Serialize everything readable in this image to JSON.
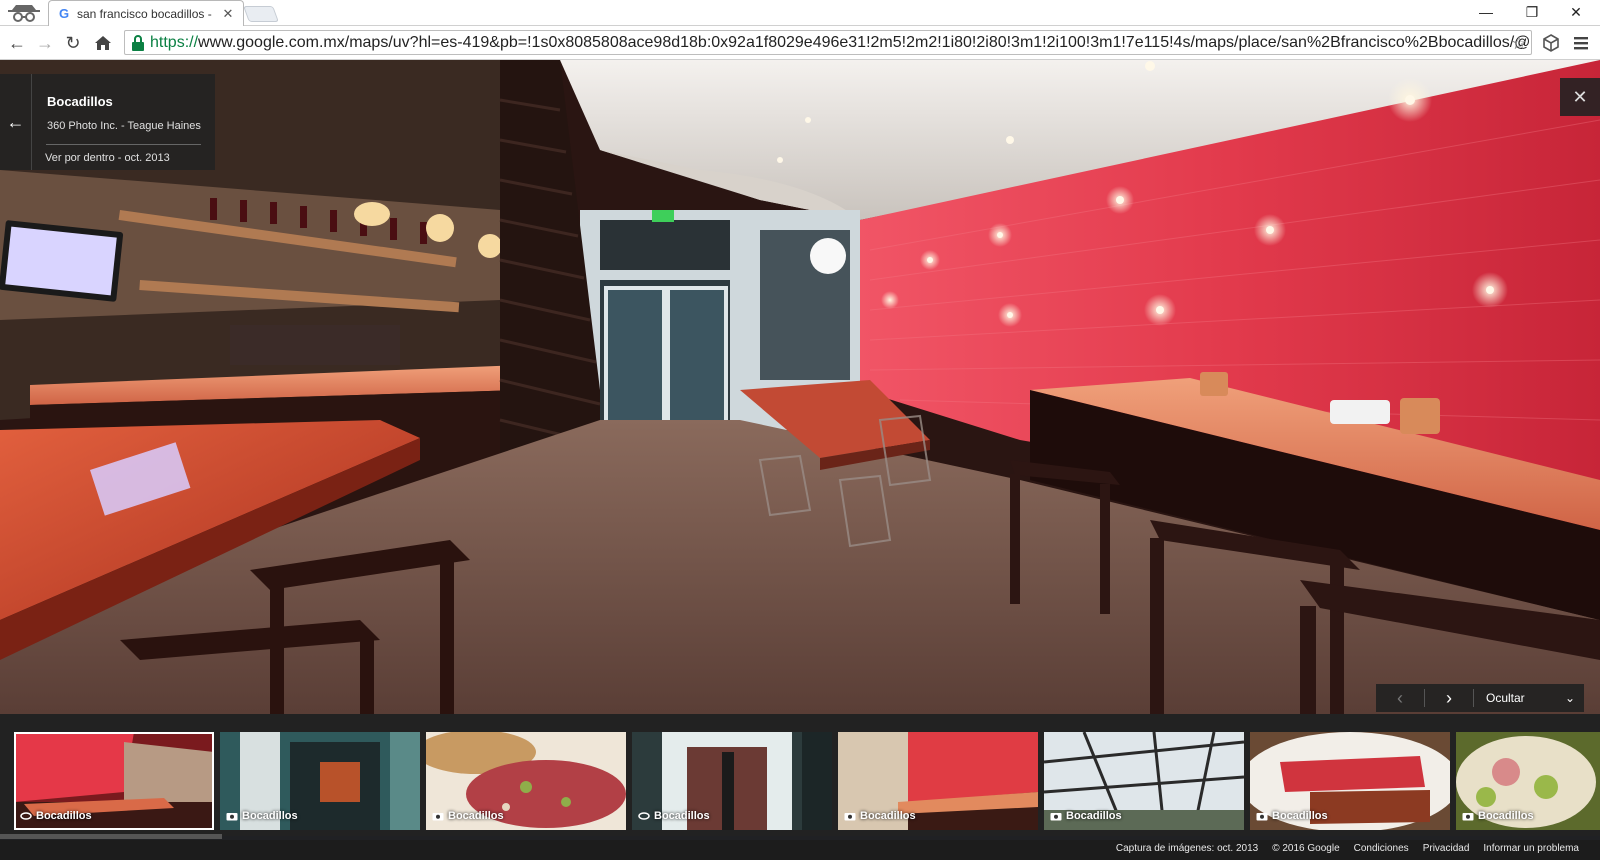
{
  "browser": {
    "tab_title": "san francisco bocadillos - ",
    "tab_favicon": "G",
    "url_scheme": "https://",
    "url_rest": "www.google.com.mx/maps/uv?hl=es-419&pb=!1s0x8085808ace98d18b:0x92a1f8029e496e31!2m5!2m2!1i80!2i80!3m1!2i100!3m1!7e115!4s/maps/place/san%2Bfrancisco%2Bbocadillos/@",
    "secure_color": "#0b8043"
  },
  "streetview": {
    "place_name": "Bocadillos",
    "credit": "360 Photo Inc. - Teague Haines",
    "date_label": "Ver por dentro - oct. 2013",
    "hide_label": "Ocultar"
  },
  "photos": [
    {
      "label": "Bocadillos",
      "kind": "360-icon"
    },
    {
      "label": "Bocadillos",
      "kind": "camera-icon"
    },
    {
      "label": "Bocadillos",
      "kind": "camera-icon"
    },
    {
      "label": "Bocadillos",
      "kind": "360-icon"
    },
    {
      "label": "Bocadillos",
      "kind": "camera-icon"
    },
    {
      "label": "Bocadillos",
      "kind": "camera-icon"
    },
    {
      "label": "Bocadillos",
      "kind": "camera-icon"
    },
    {
      "label": "Bocadillos",
      "kind": "camera-icon"
    }
  ],
  "footer": {
    "capture": "Captura de imágenes: oct. 2013",
    "copyright": "© 2016 Google",
    "terms": "Condiciones",
    "privacy": "Privacidad",
    "report": "Informar un problema"
  }
}
